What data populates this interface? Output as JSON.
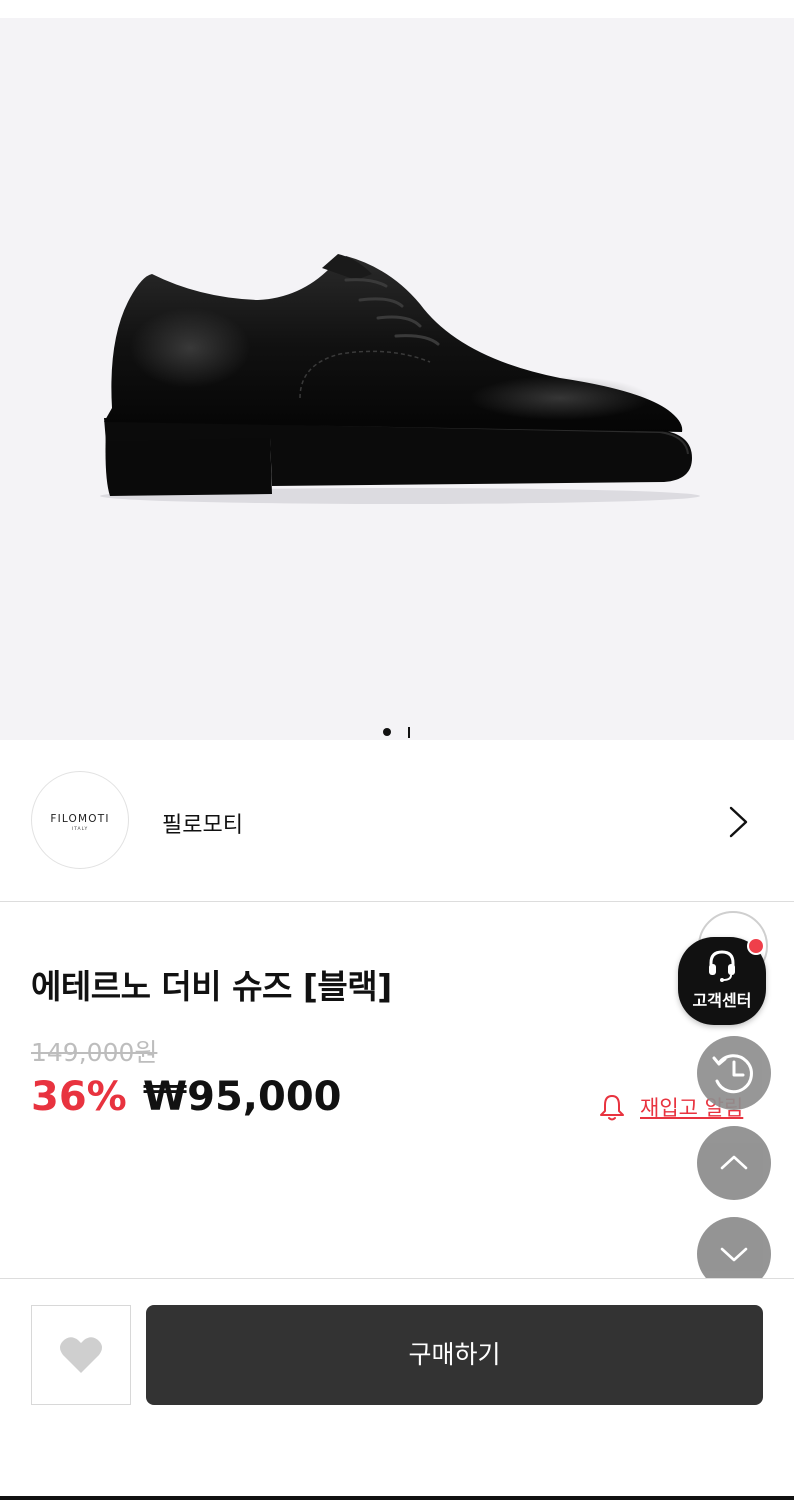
{
  "colors": {
    "accent_red": "#e8333f",
    "buy_button": "#333333",
    "gallery_bg": "#f4f3f6"
  },
  "gallery": {
    "image_subject": "black leather derby shoe",
    "current_slide": 1
  },
  "brand": {
    "logo_text": "FILOMOTI",
    "logo_subtext": "ITALY",
    "name": "필로모티",
    "chevron_icon": "chevron-right-icon"
  },
  "product": {
    "title": "에테르노 더비 슈즈 [블랙]",
    "original_price": "149,000원",
    "discount": "36%",
    "sale_price": "₩95,000"
  },
  "restock": {
    "icon": "bell-icon",
    "label": "재입고 알림"
  },
  "floating": {
    "customer_center_label": "고객센터",
    "customer_center_icon": "headset-icon",
    "recent_icon": "history-icon",
    "scroll_up_icon": "chevron-up-icon",
    "scroll_down_icon": "chevron-down-icon"
  },
  "bottom_bar": {
    "like_icon": "heart-icon",
    "buy_label": "구매하기"
  }
}
